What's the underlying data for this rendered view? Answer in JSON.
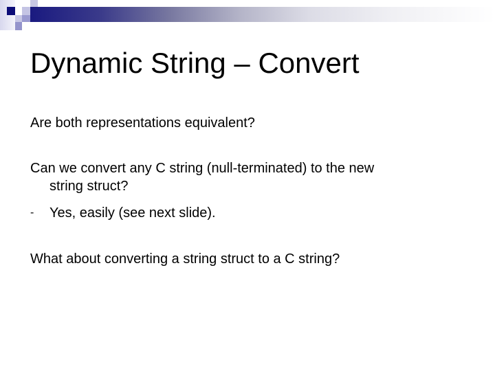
{
  "slide": {
    "title": "Dynamic String – Convert",
    "paragraphs": [
      {
        "text": "Are both representations equivalent?"
      },
      {
        "text_line1": "Can we convert any C string (null-terminated) to the new",
        "text_line2": "string struct?",
        "sub_bullets": [
          {
            "marker": "-",
            "text": "Yes, easily (see next slide)."
          }
        ]
      },
      {
        "text": "What about converting a string struct to a C string?"
      }
    ]
  },
  "theme": {
    "accent_dark": "#1a1a80",
    "accent_medium": "#8e8ec4",
    "accent_light": "#c8c8e6",
    "background": "#ffffff",
    "text_color": "#000000"
  }
}
